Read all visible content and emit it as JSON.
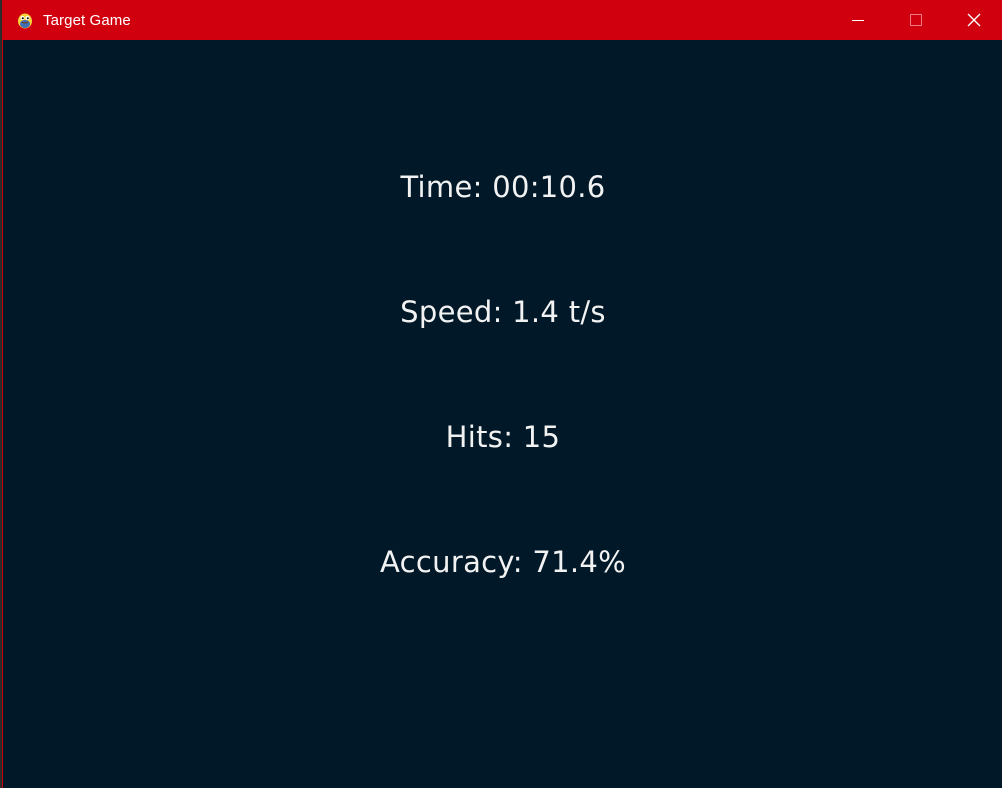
{
  "window": {
    "title": "Target Game",
    "app_icon": "python-snake-icon",
    "controls": {
      "minimize_icon": "minimize-icon",
      "maximize_icon": "maximize-icon",
      "close_icon": "close-icon"
    },
    "colors": {
      "titlebar": "#d0000e",
      "background": "#001828",
      "text": "#f2f2f2"
    }
  },
  "stats": {
    "time": "Time: 00:10.6",
    "speed": "Speed: 1.4 t/s",
    "hits": "Hits: 15",
    "accuracy": "Accuracy: 71.4%"
  }
}
